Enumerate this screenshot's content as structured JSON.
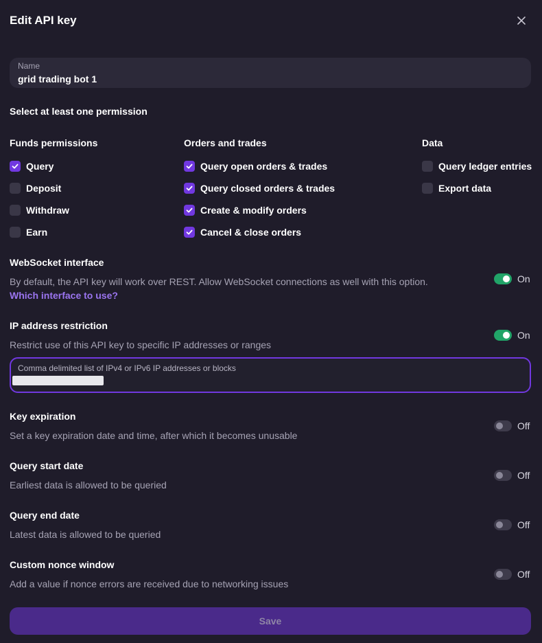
{
  "dialog": {
    "title": "Edit API key"
  },
  "name_field": {
    "label": "Name",
    "value": "grid trading bot 1"
  },
  "permissions": {
    "heading": "Select at least one permission",
    "columns": [
      {
        "title": "Funds permissions",
        "items": [
          {
            "label": "Query",
            "checked": true
          },
          {
            "label": "Deposit",
            "checked": false
          },
          {
            "label": "Withdraw",
            "checked": false
          },
          {
            "label": "Earn",
            "checked": false
          }
        ]
      },
      {
        "title": "Orders and trades",
        "items": [
          {
            "label": "Query open orders & trades",
            "checked": true
          },
          {
            "label": "Query closed orders & trades",
            "checked": true
          },
          {
            "label": "Create & modify orders",
            "checked": true
          },
          {
            "label": "Cancel & close orders",
            "checked": true
          }
        ]
      },
      {
        "title": "Data",
        "items": [
          {
            "label": "Query ledger entries",
            "checked": false
          },
          {
            "label": "Export data",
            "checked": false
          }
        ]
      }
    ]
  },
  "websocket": {
    "title": "WebSocket interface",
    "description": "By default, the API key will work over REST. Allow WebSocket connections as well with this option.",
    "link": "Which interface to use?",
    "state": "On"
  },
  "ip_restriction": {
    "title": "IP address restriction",
    "description": "Restrict use of this API key to specific IP addresses or ranges",
    "state": "On",
    "field_label": "Comma delimited list of IPv4 or IPv6 IP addresses or blocks"
  },
  "key_expiration": {
    "title": "Key expiration",
    "description": "Set a key expiration date and time, after which it becomes unusable",
    "state": "Off"
  },
  "query_start": {
    "title": "Query start date",
    "description": "Earliest data is allowed to be queried",
    "state": "Off"
  },
  "query_end": {
    "title": "Query end date",
    "description": "Latest data is allowed to be queried",
    "state": "Off"
  },
  "nonce_window": {
    "title": "Custom nonce window",
    "description": "Add a value if nonce errors are received due to networking issues",
    "state": "Off"
  },
  "save_label": "Save",
  "colors": {
    "background": "#1f1c2a",
    "accent": "#7138e0",
    "toggle_on": "#21a468",
    "link": "#9b75f0",
    "save_button": "#4a2a8a"
  },
  "icons": {
    "close": "close-icon",
    "check": "check-icon"
  }
}
